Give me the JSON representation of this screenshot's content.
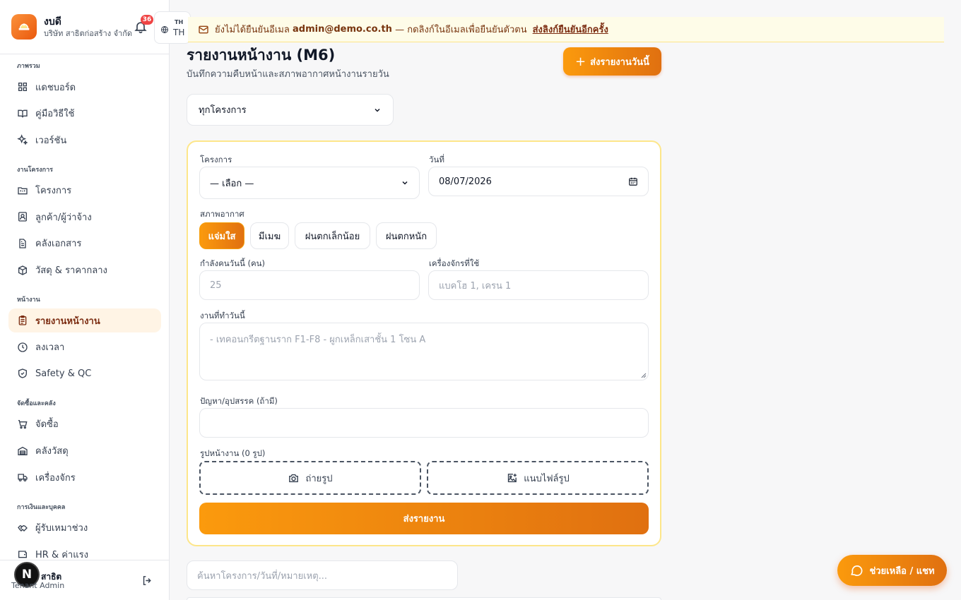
{
  "brand": {
    "name": "งบดี",
    "company": "บริษัท สาธิตก่อสร้าง จำกัด"
  },
  "notifications": {
    "count": "36"
  },
  "language": {
    "small": "TH",
    "current": "TH"
  },
  "nav": {
    "sections": [
      {
        "title": "ภาพรวม",
        "items": [
          {
            "label": "แดชบอร์ด",
            "icon": "dashboard-icon"
          },
          {
            "label": "คู่มือวิธีใช้",
            "icon": "book-icon"
          },
          {
            "label": "เวอร์ชัน",
            "icon": "sparkles-icon"
          }
        ]
      },
      {
        "title": "งานโครงการ",
        "items": [
          {
            "label": "โครงการ",
            "icon": "folder-icon"
          },
          {
            "label": "ลูกค้า/ผู้ว่าจ้าง",
            "icon": "contact-icon"
          },
          {
            "label": "คลังเอกสาร",
            "icon": "document-icon"
          },
          {
            "label": "วัสดุ & ราคากลาง",
            "icon": "package-icon"
          }
        ]
      },
      {
        "title": "หน้างาน",
        "items": [
          {
            "label": "รายงานหน้างาน",
            "icon": "clipboard-icon",
            "active": true
          },
          {
            "label": "ลงเวลา",
            "icon": "clock-icon"
          },
          {
            "label": "Safety & QC",
            "icon": "shield-check-icon"
          }
        ]
      },
      {
        "title": "จัดซื้อและคลัง",
        "items": [
          {
            "label": "จัดซื้อ",
            "icon": "cart-icon"
          },
          {
            "label": "คลังวัสดุ",
            "icon": "warehouse-icon"
          },
          {
            "label": "เครื่องจักร",
            "icon": "truck-icon"
          }
        ]
      },
      {
        "title": "การเงินและบุคคล",
        "items": [
          {
            "label": "ผู้รับเหมาช่วง",
            "icon": "handshake-icon"
          },
          {
            "label": "HR & ค่าแรง",
            "icon": "wallet-icon"
          }
        ]
      }
    ]
  },
  "user": {
    "avatar_letter": "N",
    "name": "สาธิต",
    "role": "Tenant Admin"
  },
  "banner": {
    "prefix": "ยังไม่ได้ยืนยันอีเมล",
    "email": "admin@demo.co.th",
    "suffix": "— กดลิงก์ในอีเมลเพื่อยืนยันตัวตน",
    "link": "ส่งลิงก์ยืนยันอีกครั้ง"
  },
  "page": {
    "title": "รายงานหน้างาน (M6)",
    "subtitle": "บันทึกความคืบหน้าและสภาพอากาศหน้างานรายวัน",
    "submit_today": "ส่งรายงานวันนี้",
    "project_filter": "ทุกโครงการ"
  },
  "form": {
    "project_label": "โครงการ",
    "project_value": "— เลือก —",
    "date_label": "วันที่",
    "date_value": "08/07/2026",
    "weather_label": "สภาพอากาศ",
    "weather_options": [
      "แจ่มใส",
      "มีเมฆ",
      "ฝนตกเล็กน้อย",
      "ฝนตกหนัก"
    ],
    "weather_selected": "แจ่มใส",
    "manpower_label": "กำลังคนวันนี้ (คน)",
    "manpower_placeholder": "25",
    "machines_label": "เครื่องจักรที่ใช้",
    "machines_placeholder": "แบคโฮ 1, เครน 1",
    "work_label": "งานที่ทำวันนี้",
    "work_placeholder": "- เทคอนกรีตฐานราก F1-F8 - ผูกเหล็กเสาชั้น 1 โซน A",
    "issues_label": "ปัญหา/อุปสรรค (ถ้ามี)",
    "issues_value": "",
    "photos_label": "รูปหน้างาน (0 รูป)",
    "take_photo": "ถ่ายรูป",
    "attach_photo": "แนบไฟล์รูป",
    "send": "ส่งรายงาน"
  },
  "search": {
    "placeholder": "ค้นหาโครงการ/วันที่/หมายเหตุ..."
  },
  "help": {
    "label": "ช่วยเหลือ / แชท"
  },
  "colors": {
    "accent": "#f59e0b",
    "accent_dark": "#e07010",
    "banner_bg": "#fefce8"
  }
}
